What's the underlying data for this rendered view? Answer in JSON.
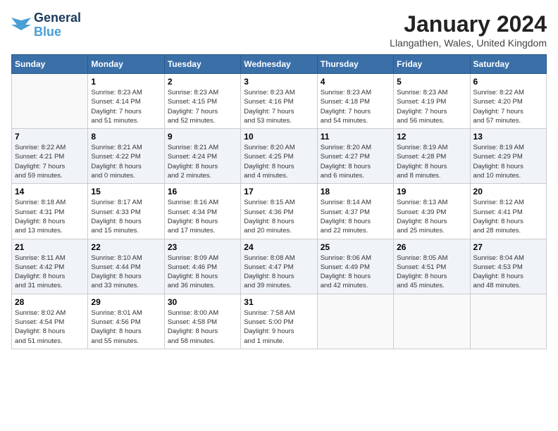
{
  "header": {
    "logo_line1": "General",
    "logo_line2": "Blue",
    "month_title": "January 2024",
    "location": "Llangathen, Wales, United Kingdom"
  },
  "days_of_week": [
    "Sunday",
    "Monday",
    "Tuesday",
    "Wednesday",
    "Thursday",
    "Friday",
    "Saturday"
  ],
  "weeks": [
    [
      {
        "day": "",
        "info": ""
      },
      {
        "day": "1",
        "info": "Sunrise: 8:23 AM\nSunset: 4:14 PM\nDaylight: 7 hours\nand 51 minutes."
      },
      {
        "day": "2",
        "info": "Sunrise: 8:23 AM\nSunset: 4:15 PM\nDaylight: 7 hours\nand 52 minutes."
      },
      {
        "day": "3",
        "info": "Sunrise: 8:23 AM\nSunset: 4:16 PM\nDaylight: 7 hours\nand 53 minutes."
      },
      {
        "day": "4",
        "info": "Sunrise: 8:23 AM\nSunset: 4:18 PM\nDaylight: 7 hours\nand 54 minutes."
      },
      {
        "day": "5",
        "info": "Sunrise: 8:23 AM\nSunset: 4:19 PM\nDaylight: 7 hours\nand 56 minutes."
      },
      {
        "day": "6",
        "info": "Sunrise: 8:22 AM\nSunset: 4:20 PM\nDaylight: 7 hours\nand 57 minutes."
      }
    ],
    [
      {
        "day": "7",
        "info": "Sunrise: 8:22 AM\nSunset: 4:21 PM\nDaylight: 7 hours\nand 59 minutes."
      },
      {
        "day": "8",
        "info": "Sunrise: 8:21 AM\nSunset: 4:22 PM\nDaylight: 8 hours\nand 0 minutes."
      },
      {
        "day": "9",
        "info": "Sunrise: 8:21 AM\nSunset: 4:24 PM\nDaylight: 8 hours\nand 2 minutes."
      },
      {
        "day": "10",
        "info": "Sunrise: 8:20 AM\nSunset: 4:25 PM\nDaylight: 8 hours\nand 4 minutes."
      },
      {
        "day": "11",
        "info": "Sunrise: 8:20 AM\nSunset: 4:27 PM\nDaylight: 8 hours\nand 6 minutes."
      },
      {
        "day": "12",
        "info": "Sunrise: 8:19 AM\nSunset: 4:28 PM\nDaylight: 8 hours\nand 8 minutes."
      },
      {
        "day": "13",
        "info": "Sunrise: 8:19 AM\nSunset: 4:29 PM\nDaylight: 8 hours\nand 10 minutes."
      }
    ],
    [
      {
        "day": "14",
        "info": "Sunrise: 8:18 AM\nSunset: 4:31 PM\nDaylight: 8 hours\nand 13 minutes."
      },
      {
        "day": "15",
        "info": "Sunrise: 8:17 AM\nSunset: 4:33 PM\nDaylight: 8 hours\nand 15 minutes."
      },
      {
        "day": "16",
        "info": "Sunrise: 8:16 AM\nSunset: 4:34 PM\nDaylight: 8 hours\nand 17 minutes."
      },
      {
        "day": "17",
        "info": "Sunrise: 8:15 AM\nSunset: 4:36 PM\nDaylight: 8 hours\nand 20 minutes."
      },
      {
        "day": "18",
        "info": "Sunrise: 8:14 AM\nSunset: 4:37 PM\nDaylight: 8 hours\nand 22 minutes."
      },
      {
        "day": "19",
        "info": "Sunrise: 8:13 AM\nSunset: 4:39 PM\nDaylight: 8 hours\nand 25 minutes."
      },
      {
        "day": "20",
        "info": "Sunrise: 8:12 AM\nSunset: 4:41 PM\nDaylight: 8 hours\nand 28 minutes."
      }
    ],
    [
      {
        "day": "21",
        "info": "Sunrise: 8:11 AM\nSunset: 4:42 PM\nDaylight: 8 hours\nand 31 minutes."
      },
      {
        "day": "22",
        "info": "Sunrise: 8:10 AM\nSunset: 4:44 PM\nDaylight: 8 hours\nand 33 minutes."
      },
      {
        "day": "23",
        "info": "Sunrise: 8:09 AM\nSunset: 4:46 PM\nDaylight: 8 hours\nand 36 minutes."
      },
      {
        "day": "24",
        "info": "Sunrise: 8:08 AM\nSunset: 4:47 PM\nDaylight: 8 hours\nand 39 minutes."
      },
      {
        "day": "25",
        "info": "Sunrise: 8:06 AM\nSunset: 4:49 PM\nDaylight: 8 hours\nand 42 minutes."
      },
      {
        "day": "26",
        "info": "Sunrise: 8:05 AM\nSunset: 4:51 PM\nDaylight: 8 hours\nand 45 minutes."
      },
      {
        "day": "27",
        "info": "Sunrise: 8:04 AM\nSunset: 4:53 PM\nDaylight: 8 hours\nand 48 minutes."
      }
    ],
    [
      {
        "day": "28",
        "info": "Sunrise: 8:02 AM\nSunset: 4:54 PM\nDaylight: 8 hours\nand 51 minutes."
      },
      {
        "day": "29",
        "info": "Sunrise: 8:01 AM\nSunset: 4:56 PM\nDaylight: 8 hours\nand 55 minutes."
      },
      {
        "day": "30",
        "info": "Sunrise: 8:00 AM\nSunset: 4:58 PM\nDaylight: 8 hours\nand 58 minutes."
      },
      {
        "day": "31",
        "info": "Sunrise: 7:58 AM\nSunset: 5:00 PM\nDaylight: 9 hours\nand 1 minute."
      },
      {
        "day": "",
        "info": ""
      },
      {
        "day": "",
        "info": ""
      },
      {
        "day": "",
        "info": ""
      }
    ]
  ]
}
